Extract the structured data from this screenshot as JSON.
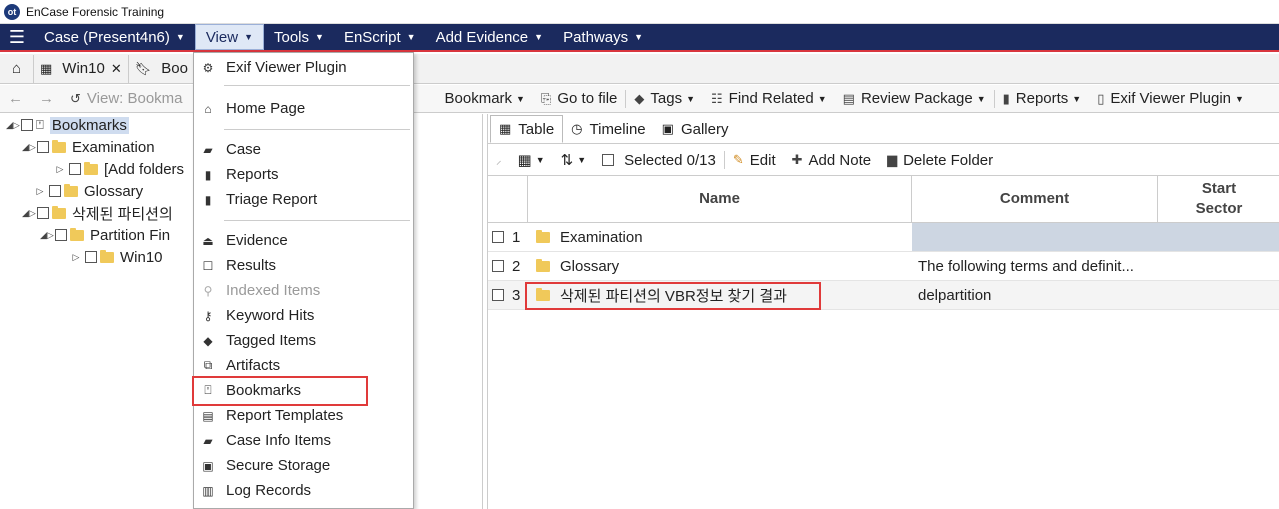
{
  "window": {
    "logo_text": "ot",
    "title": "EnCase Forensic Training"
  },
  "menubar": {
    "items": [
      {
        "label": "Case (Present4n6)"
      },
      {
        "label": "View"
      },
      {
        "label": "Tools"
      },
      {
        "label": "EnScript"
      },
      {
        "label": "Add Evidence"
      },
      {
        "label": "Pathways"
      }
    ]
  },
  "tabs": [
    {
      "label": "Win10"
    },
    {
      "label": "Boo"
    }
  ],
  "toolbar": {
    "view_label": "View: Bookma",
    "bookmark": "Bookmark",
    "goto_file": "Go to file",
    "tags": "Tags",
    "find_related": "Find Related",
    "review_package": "Review Package",
    "reports": "Reports",
    "exif_plugin": "Exif Viewer Plugin"
  },
  "tree": {
    "items": [
      {
        "label": "Bookmarks"
      },
      {
        "label": "Examination"
      },
      {
        "label": "[Add folders"
      },
      {
        "label": "Glossary"
      },
      {
        "label": "삭제된 파티션의"
      },
      {
        "label": "Partition Fin"
      },
      {
        "label": "Win10"
      }
    ]
  },
  "view_menu": {
    "items": [
      {
        "label": "Exif Viewer Plugin",
        "icon": "gears-icon"
      },
      {
        "label": "Home Page",
        "icon": "home-icon"
      },
      {
        "label": "Case",
        "icon": "briefcase-icon"
      },
      {
        "label": "Reports",
        "icon": "report-icon"
      },
      {
        "label": "Triage Report",
        "icon": "triage-report-icon"
      },
      {
        "label": "Evidence",
        "icon": "evidence-icon"
      },
      {
        "label": "Results",
        "icon": "results-icon"
      },
      {
        "label": "Indexed Items",
        "icon": "search-icon"
      },
      {
        "label": "Keyword Hits",
        "icon": "key-icon"
      },
      {
        "label": "Tagged Items",
        "icon": "tag-icon"
      },
      {
        "label": "Artifacts",
        "icon": "artifacts-icon"
      },
      {
        "label": "Bookmarks",
        "icon": "bookmark-icon"
      },
      {
        "label": "Report Templates",
        "icon": "report-template-icon"
      },
      {
        "label": "Case Info Items",
        "icon": "case-info-icon"
      },
      {
        "label": "Secure Storage",
        "icon": "lock-icon"
      },
      {
        "label": "Log Records",
        "icon": "clipboard-icon"
      }
    ]
  },
  "right_tabs": [
    {
      "label": "Table"
    },
    {
      "label": "Timeline"
    },
    {
      "label": "Gallery"
    }
  ],
  "table_toolbar": {
    "selected": "Selected 0/13",
    "edit": "Edit",
    "add_note": "Add Note",
    "delete_folder": "Delete Folder"
  },
  "table": {
    "columns": {
      "name": "Name",
      "comment": "Comment",
      "start_sector_1": "Start",
      "start_sector_2": "Sector"
    },
    "rows": [
      {
        "num": "1",
        "name": "Examination",
        "comment": ""
      },
      {
        "num": "2",
        "name": "Glossary",
        "comment": "The following terms and definit..."
      },
      {
        "num": "3",
        "name": "삭제된 파티션의 VBR정보 찾기 결과",
        "comment": "delpartition"
      }
    ]
  }
}
